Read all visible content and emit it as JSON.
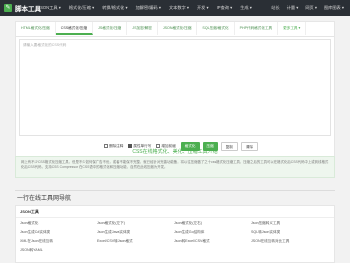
{
  "header": {
    "logo_glyph": "✎",
    "site_name": "脚本工具",
    "nav": [
      "JSON工具 ▾",
      "格式化/压缩 ▾",
      "转换/格式化 ▾",
      "加解密/编码 ▾",
      "文本数字 ▾",
      "开发 ▾",
      "IP查询 ▾",
      "生成 ▾"
    ],
    "nav_right": [
      "站长",
      "计量 ▾",
      "网页 ▾",
      "图库图表 ▾"
    ]
  },
  "tabs": [
    {
      "label": "HTML格式化/压缩",
      "active": false
    },
    {
      "label": "CSS格式化/压缩",
      "active": true
    },
    {
      "label": "JS格式化/压缩",
      "active": false
    },
    {
      "label": "JS加密/解密",
      "active": false
    },
    {
      "label": "JSON格式化/压缩",
      "active": false
    },
    {
      "label": "SQL压缩/格式化",
      "active": false
    },
    {
      "label": "PHP代码格式化工具",
      "active": false
    },
    {
      "label": "更多工具 ▾",
      "active": false
    }
  ],
  "editor": {
    "placeholder": "请输入要格式化的CSS代码"
  },
  "controls": {
    "checkbox_1": {
      "label": "删除注释",
      "checked": false
    },
    "checkbox_2": {
      "label": "属性单行写",
      "checked": true
    },
    "checkbox_3": {
      "label": "增加前缀",
      "checked": false
    },
    "btn_format": "格式化",
    "btn_compress": "压缩",
    "btn_copy": "复制",
    "btn_clear": "清除"
  },
  "info": {
    "title": "CSS在线格式化、美化、压缩工具介绍",
    "text": "网上有不少CSS格式化压缩工具，但是不少如何保广告不优，或者不能保不完整，就已经针对完善功能备，将以往压缩做了之十css格式化压缩工具，压缩之后的工具可以在格式化后CSS代码中上或到线格式化后CSS代码，支持CSS Compressor 在CSS语中的格式化和压缩功能，自然在此线压缩为开发。"
  },
  "nav_section": {
    "heading": "一行在线工具网导航",
    "json_tools": {
      "title": "JSON工具",
      "links": [
        [
          "Json格式化",
          "Json格式化(左下)",
          "Json格式化(左右)",
          "Json压缩转义工具"
        ],
        [
          "Json生成C#实体类",
          "Json生成Java实体类",
          "Json生成Go结构体",
          "SQL转Json实体类"
        ],
        [
          "XML在Json在线互转",
          "Excel/CSV转Json格式",
          "Json转Excel/CSV格式",
          "JSON在线互转对比工具"
        ],
        [
          "JSON转YAML",
          "",
          "",
          ""
        ]
      ]
    }
  }
}
